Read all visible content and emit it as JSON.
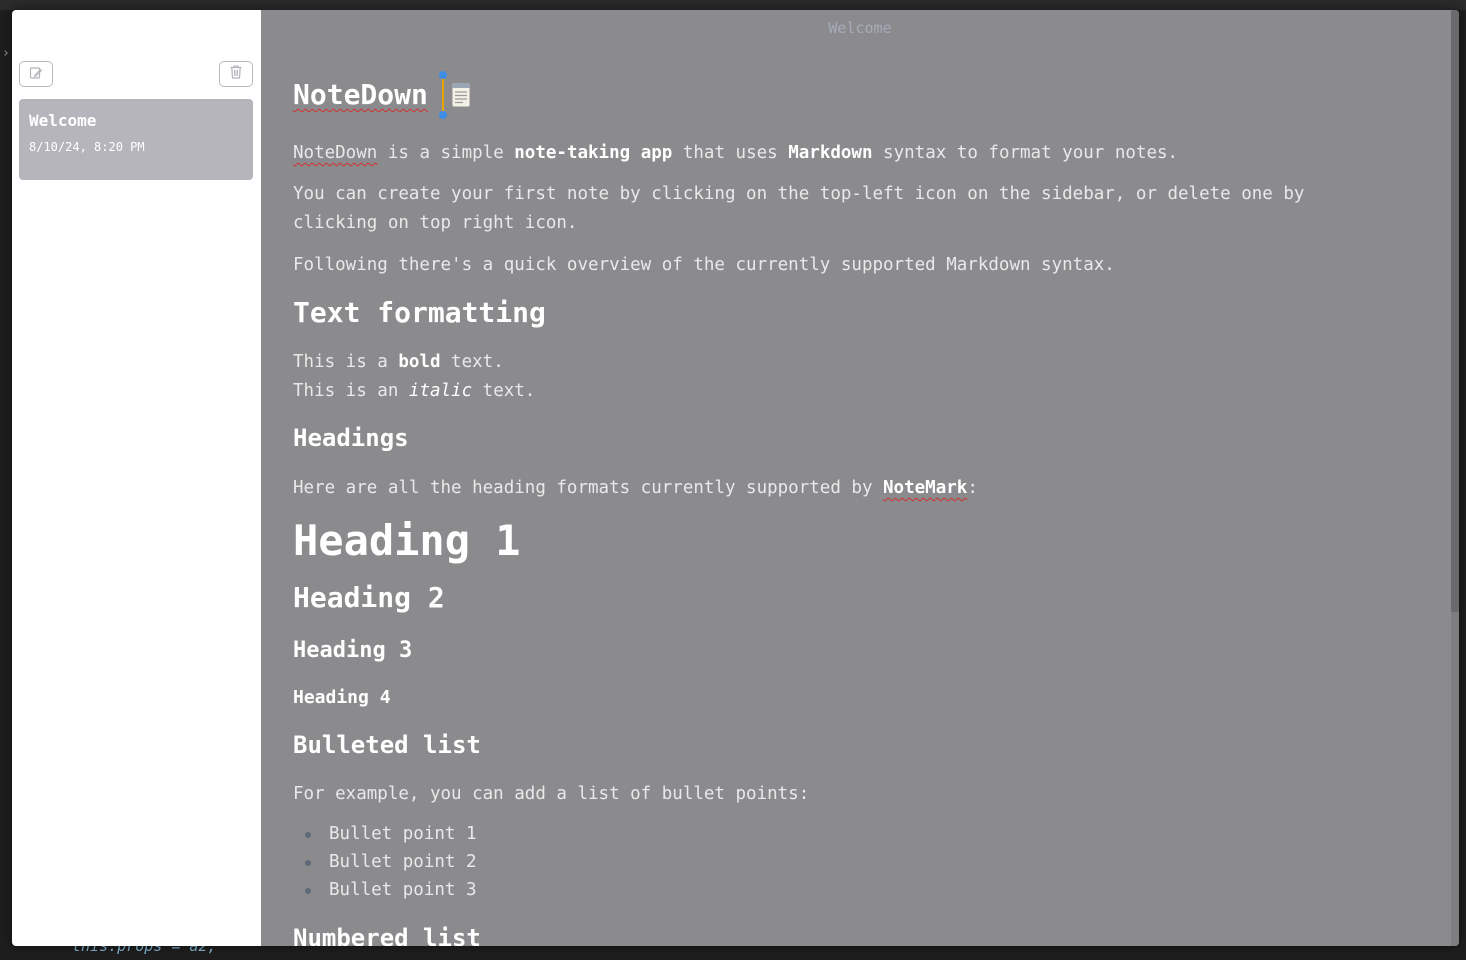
{
  "window": {
    "title": "Welcome"
  },
  "sidebar": {
    "new_note_icon": "compose-icon",
    "delete_note_icon": "trash-icon",
    "notes": [
      {
        "title": "Welcome",
        "date": "8/10/24, 8:20 PM"
      }
    ]
  },
  "document": {
    "title": "NoteDown",
    "intro": {
      "name": "NoteDown",
      "t1": " is a simple ",
      "b1": "note-taking app",
      "t2": " that uses ",
      "b2": "Markdown",
      "t3": " syntax to format your notes."
    },
    "para_create_line1": "You can create your first note by clicking on the top-left icon on the sidebar, or delete one by",
    "para_create_line2": "clicking on top right icon.",
    "para_overview": "Following there's a quick overview of the currently supported Markdown syntax.",
    "section_text_formatting": "Text formatting",
    "bold_line": {
      "pre": "This is a ",
      "bold": "bold",
      "post": " text."
    },
    "italic_line": {
      "pre": "This is an ",
      "italic": "italic",
      "post": " text."
    },
    "section_headings": "Headings",
    "headings_intro": {
      "pre": "Here are all the heading formats currently supported by ",
      "bold": "NoteMark",
      "post": ":"
    },
    "heading1": "Heading 1",
    "heading2": "Heading 2",
    "heading3": "Heading 3",
    "heading4": "Heading 4",
    "section_bulleted": "Bulleted list",
    "bulleted_intro": "For example, you can add a list of bullet points:",
    "bullets": [
      "Bullet point 1",
      "Bullet point 2",
      "Bullet point 3"
    ],
    "section_numbered": "Numbered list"
  },
  "background": {
    "bottom_code": "this.props = a2;"
  }
}
